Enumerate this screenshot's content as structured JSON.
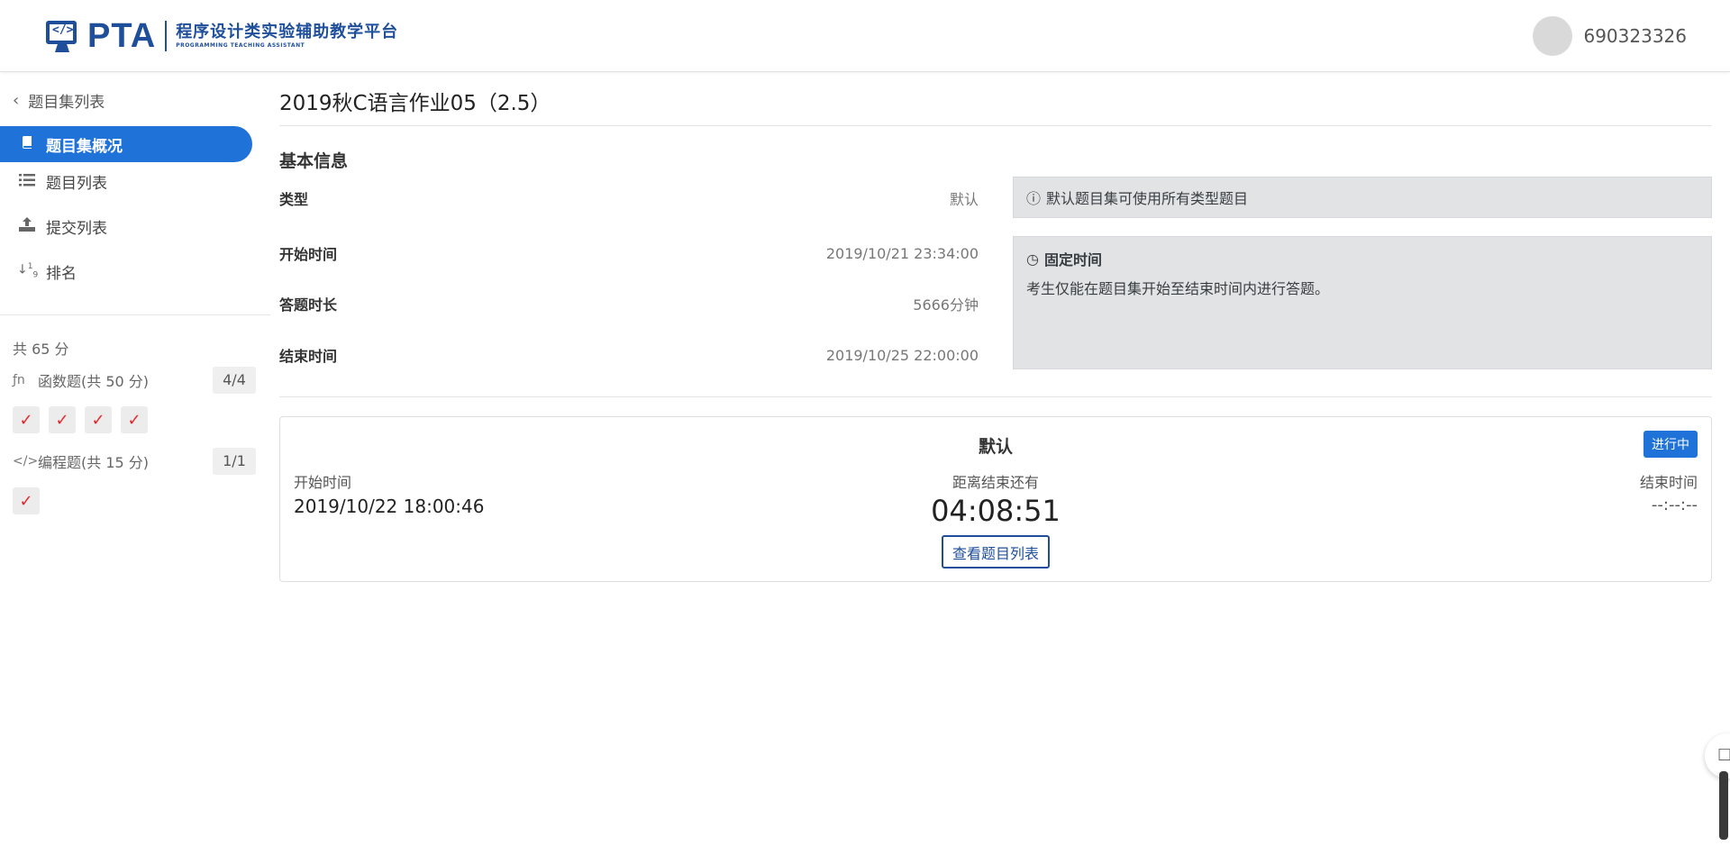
{
  "header": {
    "logo_text": "PTA",
    "logo_cn": "程序设计类实验辅助教学平台",
    "logo_en": "PROGRAMMING TEACHING ASSISTANT",
    "username": "690323326"
  },
  "sidebar": {
    "back_label": "题目集列表",
    "items": [
      {
        "label": "题目集概况",
        "icon": "book-icon",
        "active": true
      },
      {
        "label": "题目列表",
        "icon": "list-icon",
        "active": false
      },
      {
        "label": "提交列表",
        "icon": "upload-icon",
        "active": false
      },
      {
        "label": "排名",
        "icon": "sort-numeric-icon",
        "active": false
      }
    ],
    "total": "共 65 分",
    "categories": [
      {
        "label": "函数题(共 50 分)",
        "count": "4/4",
        "icon": "function-icon",
        "solved": 4
      },
      {
        "label": "编程题(共 15 分)",
        "count": "1/1",
        "icon": "code-icon",
        "solved": 1
      }
    ]
  },
  "main": {
    "title": "2019秋C语言作业05（2.5）",
    "section_title": "基本信息",
    "info": [
      {
        "key": "类型",
        "value": "默认"
      },
      {
        "key": "开始时间",
        "value": "2019/10/21 23:34:00"
      },
      {
        "key": "答题时长",
        "value": "5666分钟"
      },
      {
        "key": "结束时间",
        "value": "2019/10/25 22:00:00"
      }
    ],
    "notice_type": "默认题目集可使用所有类型题目",
    "notice_fixed_title": "固定时间",
    "notice_fixed_body": "考生仅能在题目集开始至结束时间内进行答题。",
    "card": {
      "title": "默认",
      "status": "进行中",
      "start_label": "开始时间",
      "start_value": "2019/10/22 18:00:46",
      "remaining_label": "距离结束还有",
      "remaining_value": "04:08:51",
      "end_label": "结束时间",
      "end_value": "--:--:--",
      "button": "查看题目列表"
    }
  },
  "colors": {
    "brand": "#1f4f9a",
    "accent": "#1f73d8",
    "check": "#e0272c"
  }
}
